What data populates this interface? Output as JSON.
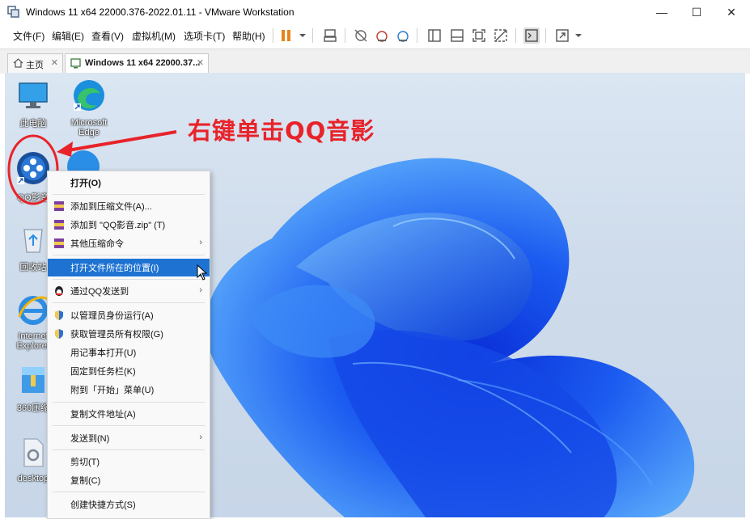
{
  "window": {
    "title": "Windows 11 x64 22000.376-2022.01.11 - VMware Workstation",
    "controls": [
      "—",
      "☐",
      "✕"
    ]
  },
  "menubar": {
    "items": [
      "文件(F)",
      "编辑(E)",
      "查看(V)",
      "虚拟机(M)",
      "选项卡(T)",
      "帮助(H)"
    ]
  },
  "tabs": [
    {
      "label": "主页"
    },
    {
      "label": "Windows 11 x64 22000.37..."
    }
  ],
  "desktop": {
    "icons": [
      {
        "label": "此电脑"
      },
      {
        "label": "Microsoft Edge"
      },
      {
        "label": "QQ影音"
      },
      {
        "label": "回收站"
      },
      {
        "label": "Internet Explorer"
      },
      {
        "label": "360压缩"
      },
      {
        "label": "desktop"
      }
    ]
  },
  "annotation": {
    "text": "右键单击QQ音影",
    "color": "#e8232a"
  },
  "context_menu": {
    "items": [
      {
        "label": "打开(O)",
        "bold": true
      },
      {
        "label": "添加到压缩文件(A)..."
      },
      {
        "label": "添加到 \"QQ影音.zip\" (T)"
      },
      {
        "label": "其他压缩命令",
        "submenu": true
      },
      {
        "label": "打开文件所在的位置(I)",
        "highlighted": true
      },
      {
        "label": "通过QQ发送到",
        "submenu": true
      },
      {
        "label": "以管理员身份运行(A)"
      },
      {
        "label": "获取管理员所有权限(G)"
      },
      {
        "label": "用记事本打开(U)"
      },
      {
        "label": "固定到任务栏(K)"
      },
      {
        "label": "附到「开始」菜单(U)"
      },
      {
        "label": "复制文件地址(A)"
      },
      {
        "label": "发送到(N)",
        "submenu": true
      },
      {
        "label": "剪切(T)"
      },
      {
        "label": "复制(C)"
      },
      {
        "label": "创建快捷方式(S)"
      }
    ],
    "highlight_color": "#1e73d2"
  }
}
